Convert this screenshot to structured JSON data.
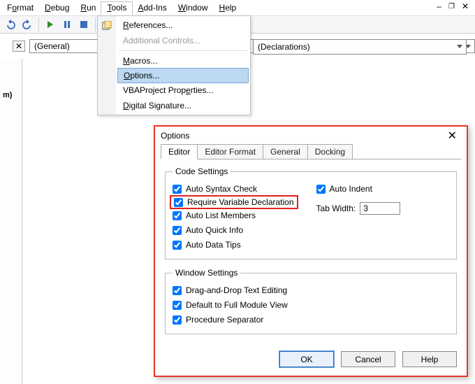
{
  "menubar": {
    "items": [
      {
        "label": "Format",
        "accel": "o"
      },
      {
        "label": "Debug",
        "accel": "D"
      },
      {
        "label": "Run",
        "accel": "R"
      },
      {
        "label": "Tools",
        "accel": "T"
      },
      {
        "label": "Add-Ins",
        "accel": "A"
      },
      {
        "label": "Window",
        "accel": "W"
      },
      {
        "label": "Help",
        "accel": "H"
      }
    ]
  },
  "tools_menu": {
    "items": [
      {
        "label": "References...",
        "accel": "R"
      },
      {
        "label": "Additional Controls...",
        "disabled": true
      },
      {
        "label": "Macros...",
        "accel": "M"
      },
      {
        "label": "Options...",
        "accel": "O",
        "highlight": true
      },
      {
        "label": "VBAProject Properties...",
        "accel": "e"
      },
      {
        "label": "Digital Signature...",
        "accel": "D"
      }
    ]
  },
  "sub_header": {
    "general_label": "(General)",
    "declarations_label": "(Declarations)"
  },
  "left_pane": {
    "label": "m)"
  },
  "dialog": {
    "title": "Options",
    "tabs": [
      "Editor",
      "Editor Format",
      "General",
      "Docking"
    ],
    "code_settings": {
      "legend": "Code Settings",
      "left": [
        "Auto Syntax Check",
        "Require Variable Declaration",
        "Auto List Members",
        "Auto Quick Info",
        "Auto Data Tips"
      ],
      "right_check": "Auto Indent",
      "tab_width_label": "Tab Width:",
      "tab_width_value": "3"
    },
    "window_settings": {
      "legend": "Window Settings",
      "items": [
        "Drag-and-Drop Text Editing",
        "Default to Full Module View",
        "Procedure Separator"
      ]
    },
    "buttons": {
      "ok": "OK",
      "cancel": "Cancel",
      "help": "Help"
    }
  }
}
